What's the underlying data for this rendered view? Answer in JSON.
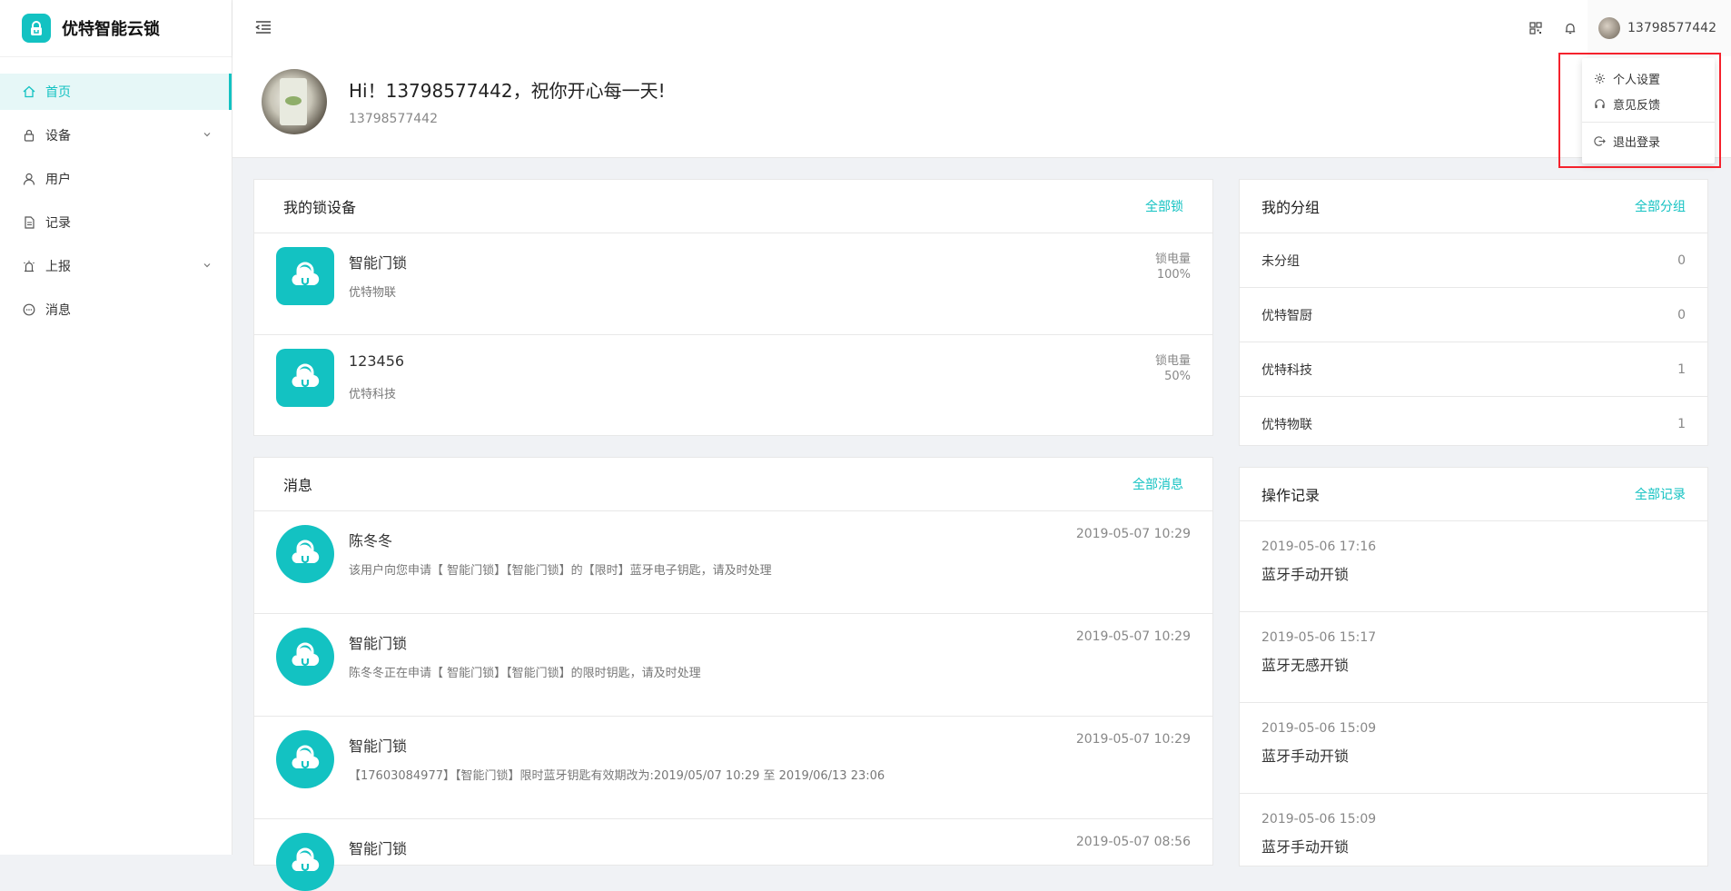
{
  "app": {
    "name": "优特智能云锁"
  },
  "sidebar": {
    "items": [
      {
        "label": "首页"
      },
      {
        "label": "设备"
      },
      {
        "label": "用户"
      },
      {
        "label": "记录"
      },
      {
        "label": "上报"
      },
      {
        "label": "消息"
      }
    ]
  },
  "header": {
    "user_name": "13798577442"
  },
  "dropdown": {
    "items": [
      {
        "label": "个人设置",
        "icon": "gear-icon"
      },
      {
        "label": "意见反馈",
        "icon": "headset-icon"
      },
      {
        "label": "退出登录",
        "icon": "logout-icon"
      }
    ]
  },
  "greeting": {
    "title": "Hi！13798577442，祝你开心每一天!",
    "subtitle": "13798577442"
  },
  "locks": {
    "title": "我的锁设备",
    "link": "全部锁",
    "battery_label": "锁电量",
    "items": [
      {
        "name": "智能门锁",
        "group": "优特物联",
        "battery": "100%"
      },
      {
        "name": "123456",
        "group": "优特科技",
        "battery": "50%"
      }
    ]
  },
  "messages": {
    "title": "消息",
    "link": "全部消息",
    "items": [
      {
        "sender": "陈冬冬",
        "time": "2019-05-07 10:29",
        "text": "该用户向您申请【 智能门锁】【智能门锁】的【限时】蓝牙电子钥匙，请及时处理"
      },
      {
        "sender": "智能门锁",
        "time": "2019-05-07 10:29",
        "text": "陈冬冬正在申请【 智能门锁】【智能门锁】的限时钥匙，请及时处理"
      },
      {
        "sender": "智能门锁",
        "time": "2019-05-07 10:29",
        "text": "【17603084977】【智能门锁】限时蓝牙钥匙有效期改为:2019/05/07 10:29 至 2019/06/13 23:06"
      },
      {
        "sender": "智能门锁",
        "time": "2019-05-07 08:56",
        "text": ""
      }
    ]
  },
  "groups": {
    "title": "我的分组",
    "link": "全部分组",
    "items": [
      {
        "name": "未分组",
        "count": "0"
      },
      {
        "name": "优特智厨",
        "count": "0"
      },
      {
        "name": "优特科技",
        "count": "1"
      },
      {
        "name": "优特物联",
        "count": "1"
      }
    ]
  },
  "records": {
    "title": "操作记录",
    "link": "全部记录",
    "items": [
      {
        "time": "2019-05-06 17:16",
        "action": "蓝牙手动开锁"
      },
      {
        "time": "2019-05-06 15:17",
        "action": "蓝牙无感开锁"
      },
      {
        "time": "2019-05-06 15:09",
        "action": "蓝牙手动开锁"
      },
      {
        "time": "2019-05-06 15:09",
        "action": "蓝牙手动开锁"
      }
    ]
  },
  "colors": {
    "accent": "#13c2c2",
    "highlight": "#f5222d"
  }
}
